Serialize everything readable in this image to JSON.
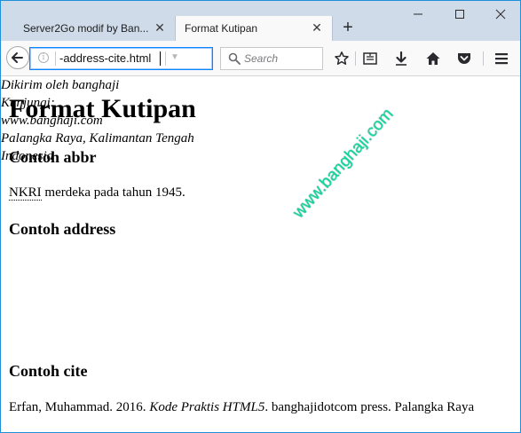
{
  "tabs": [
    {
      "title": "Server2Go modif by Ban...",
      "close": "✕",
      "active": false
    },
    {
      "title": "Format Kutipan",
      "close": "✕",
      "active": true
    }
  ],
  "new_tab_label": "+",
  "window_controls": {
    "minimize": "—",
    "maximize": "☐",
    "close": "✕"
  },
  "urlbar": {
    "value": "-address-cite.html",
    "info_icon": "i",
    "go_icon": "→",
    "dropdown_icon": "▼"
  },
  "searchbar": {
    "placeholder": "Search"
  },
  "page": {
    "heading": "Format Kutipan",
    "abbr_heading": "Contoh abbr",
    "abbr_term": "NKRI",
    "abbr_rest": " merdeka pada tahun 1945.",
    "address_heading": "Contoh address",
    "address_lines": [
      "Dikirim oleh banghaji",
      "Kunjungi:",
      "www.banghaji.com",
      "Palangka Raya, Kalimantan Tengah",
      "Indonesia"
    ],
    "cite_heading": "Contoh cite",
    "cite_before": "Erfan, Muhammad. 2016. ",
    "cite_title": "Kode Praktis HTML5",
    "cite_after": ". banghajidotcom press. Palangka Raya",
    "watermark": "www.banghaji.com"
  },
  "colors": {
    "accent": "#0a84ff",
    "tabstrip": "#cfdbe9",
    "watermark": "#15d8a1"
  }
}
